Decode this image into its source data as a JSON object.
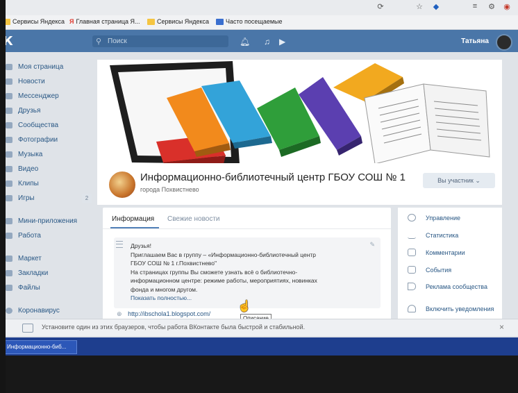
{
  "bookmarks": [
    {
      "label": "Сервисы Яндекса",
      "color": "#f5c542"
    },
    {
      "label": "Главная страница Я...",
      "color": "#e03a2f"
    },
    {
      "label": "Сервисы Яндекса",
      "color": "#f5c542"
    },
    {
      "label": "Часто посещаемые",
      "color": "#3a6fcf"
    }
  ],
  "header": {
    "logo": "К",
    "search_placeholder": "Поиск",
    "user_name": "Татьяна",
    "accent": "#4a76a8"
  },
  "menu": {
    "items": [
      {
        "label": "Моя страница",
        "icon": "home-icon"
      },
      {
        "label": "Новости",
        "icon": "news-icon"
      },
      {
        "label": "Мессенджер",
        "icon": "chat-icon"
      },
      {
        "label": "Друзья",
        "icon": "user-icon"
      },
      {
        "label": "Сообщества",
        "icon": "groups-icon"
      },
      {
        "label": "Фотографии",
        "icon": "camera-icon"
      },
      {
        "label": "Музыка",
        "icon": "music-icon"
      },
      {
        "label": "Видео",
        "icon": "video-icon"
      },
      {
        "label": "Клипы",
        "icon": "clips-icon"
      },
      {
        "label": "Игры",
        "icon": "games-icon",
        "badge": "2"
      }
    ],
    "items2": [
      {
        "label": "Мини-приложения",
        "icon": "apps-icon"
      },
      {
        "label": "Работа",
        "icon": "briefcase-icon"
      }
    ],
    "items3": [
      {
        "label": "Маркет",
        "icon": "shop-icon"
      },
      {
        "label": "Закладки",
        "icon": "star-icon"
      },
      {
        "label": "Файлы",
        "icon": "file-icon"
      }
    ],
    "items4": [
      {
        "label": "Коронавирус",
        "icon": "virus-icon"
      }
    ]
  },
  "group": {
    "title": "Информационно-библиотечный центр ГБОУ СОШ № 1",
    "subtitle": "города Похвистнево",
    "member_button": "Вы участник ⌄"
  },
  "info": {
    "tabs": [
      {
        "label": "Информация",
        "active": true
      },
      {
        "label": "Свежие новости",
        "active": false
      }
    ],
    "lines": [
      "Друзья!",
      "Приглашаем Вас в группу – «Информационно-библиотечный центр",
      "ГБОУ СОШ № 1 г.Похвистнево\"",
      "На страницах группы Вы сможете узнать всё о библиотечно-",
      "информационном центре: режиме работы, мероприятиях, новинках",
      "фонда и многом другом."
    ],
    "show_more": "Показать полностью...",
    "link": "http://ibschola1.blogspot.com/",
    "tooltip": "Описание"
  },
  "right_panel": {
    "items": [
      {
        "label": "Управление",
        "icon": "gear-icon"
      },
      {
        "label": "Статистика",
        "icon": "stats-icon"
      },
      {
        "label": "Комментарии",
        "icon": "comment-icon"
      },
      {
        "label": "События",
        "icon": "events-icon"
      },
      {
        "label": "Реклама сообщества",
        "icon": "megaphone-icon"
      },
      {
        "label": "Включить уведомления",
        "icon": "bell-icon"
      }
    ]
  },
  "notice": {
    "text": "Установите один из этих браузеров, чтобы работа ВКонтакте была быстрой и стабильной.",
    "close": "×"
  },
  "taskbar": {
    "item": "Информационно-биб..."
  }
}
